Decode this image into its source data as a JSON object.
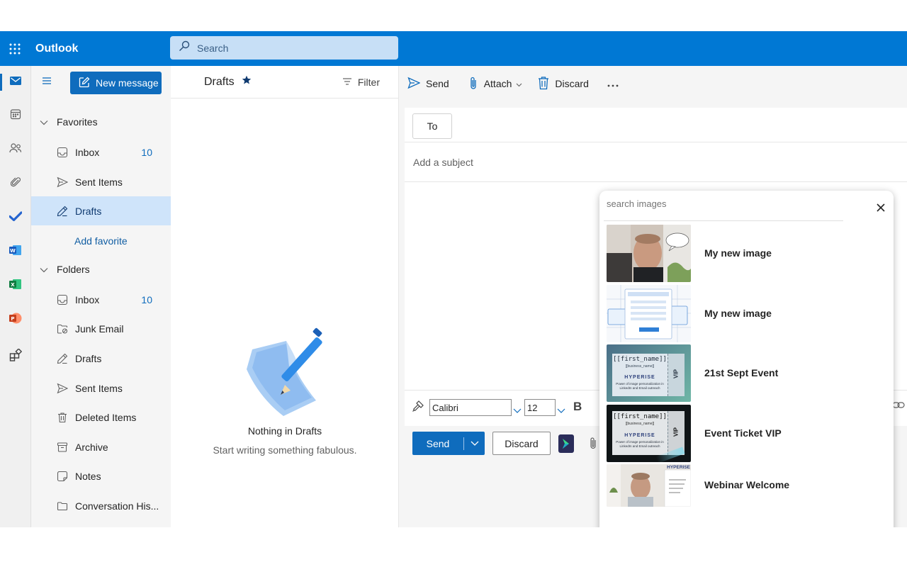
{
  "app": {
    "title": "Outlook"
  },
  "search": {
    "placeholder": "Search"
  },
  "folders": {
    "new_message": "New message",
    "favorites": "Favorites",
    "fav_items": [
      {
        "label": "Inbox",
        "count": "10"
      },
      {
        "label": "Sent Items"
      },
      {
        "label": "Drafts"
      }
    ],
    "add_favorite": "Add favorite",
    "folders_label": "Folders",
    "items": [
      {
        "label": "Inbox",
        "count": "10"
      },
      {
        "label": "Junk Email"
      },
      {
        "label": "Drafts"
      },
      {
        "label": "Sent Items"
      },
      {
        "label": "Deleted Items"
      },
      {
        "label": "Archive"
      },
      {
        "label": "Notes"
      },
      {
        "label": "Conversation His..."
      }
    ]
  },
  "list": {
    "title": "Drafts",
    "filter": "Filter",
    "empty_title": "Nothing in Drafts",
    "empty_sub": "Start writing something fabulous."
  },
  "toolbar": {
    "send": "Send",
    "attach": "Attach",
    "discard": "Discard"
  },
  "compose": {
    "to": "To",
    "subject_placeholder": "Add a subject",
    "font": "Calibri",
    "size": "12",
    "bold": "B",
    "send": "Send",
    "discard": "Discard"
  },
  "image_picker": {
    "search_placeholder": "search images",
    "images": [
      {
        "name": "My new image"
      },
      {
        "name": "My new image"
      },
      {
        "name": "21st Sept Event",
        "ticket_name": "[[first_name]]",
        "ticket_biz": "[[business_name]]",
        "ticket_brand": "HYPERISE",
        "ticket_vip": "VIP",
        "ticket_text": "Power of image personalization in LinkedIn and Email outreach"
      },
      {
        "name": "Event Ticket VIP",
        "ticket_name": "[[first_name]]",
        "ticket_biz": "[[business_name]]",
        "ticket_brand": "HYPERISE",
        "ticket_vip": "VIP",
        "ticket_text": "Power of image personalization in LinkedIn and Email outreach"
      },
      {
        "name": "Webinar Welcome",
        "brand": "HYPERISE"
      }
    ]
  },
  "colors": {
    "brand_blue": "#0078d4",
    "selected": "#cfe4fa"
  }
}
